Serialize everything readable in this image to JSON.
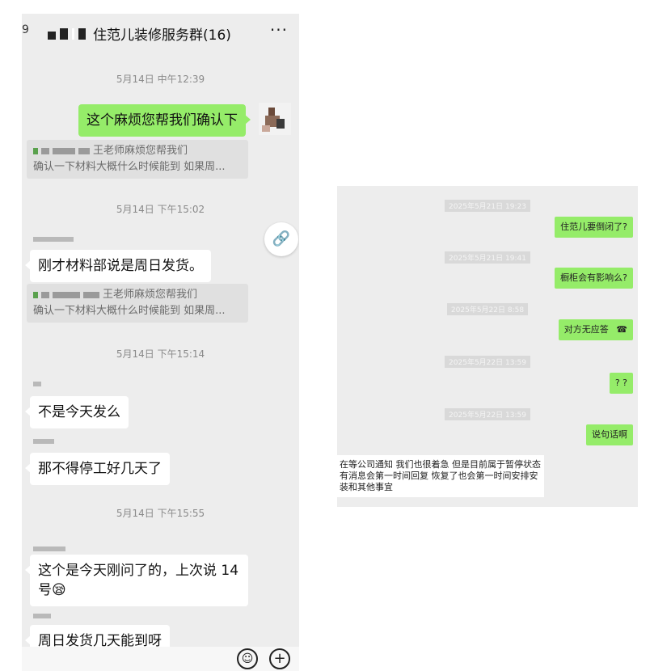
{
  "left_chat": {
    "header": {
      "back_glyph": "9",
      "title": "住范儿装修服务群(16)",
      "more_glyph": "···"
    },
    "timestamps": [
      "5月14日 中午12:39",
      "5月14日 下午15:02",
      "5月14日 下午15:14",
      "5月14日 下午15:55"
    ],
    "messages": {
      "m1": "这个麻烦您帮我们确认下",
      "m2": "刚才材料部说是周日发货。",
      "m3": "不是今天发么",
      "m4": "那不得停工好几天了",
      "m5": "这个是今天刚问了的，上次说 14 号😪",
      "m6": "周日发货几天能到呀"
    },
    "quotes": {
      "q1_line1": "王老师麻烦您帮我们",
      "q1_line2": "确认一下材料大概什么时候能到  如果周...",
      "q2_line1": "王老师麻烦您帮我们",
      "q2_line2": "确认一下材料大概什么时候能到  如果周..."
    },
    "link_icon": "link-icon",
    "bottom": {
      "emoji": "☺",
      "plus": "+"
    }
  },
  "right_chat": {
    "timestamps": [
      "2025年5月21日 19:23",
      "2025年5月21日 19:41",
      "2025年5月22日 8:58",
      "2025年5月22日 13:59",
      "2025年5月22日 13:59"
    ],
    "messages": {
      "r1": "住范儿要倒闭了?",
      "r2": "橱柜会有影响么?",
      "r3": "对方无应答",
      "r4": "? ?",
      "r5": "说句话啊"
    },
    "reply_lines": [
      "在等公司通知 我们也很着急  但是目前属于暂停状态",
      "有消息会第一时间回复  恢复了也会第一时间安排安",
      "装和其他事宜"
    ]
  },
  "colors": {
    "my_bubble": "#95ec69",
    "their_bubble": "#ffffff",
    "chat_bg": "#ededed"
  }
}
